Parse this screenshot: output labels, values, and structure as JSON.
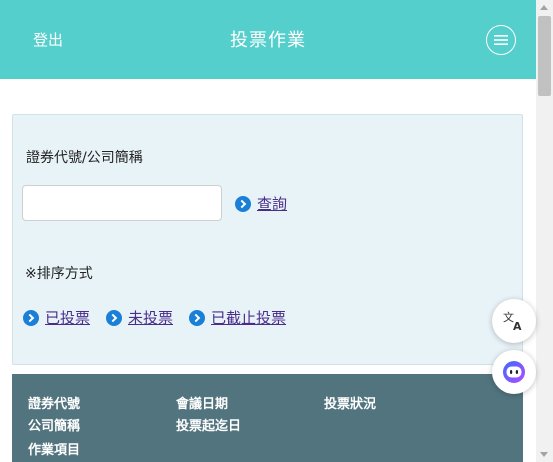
{
  "header": {
    "logout_label": "登出",
    "title": "投票作業",
    "menu_icon": "hamburger-menu-icon",
    "background": "#55cfcc"
  },
  "search": {
    "code_label": "證券代號/公司簡稱",
    "input_value": "",
    "input_placeholder": "",
    "query_label": "查詢"
  },
  "sort": {
    "label": "※排序方式",
    "options": [
      "已投票",
      "未投票",
      "已截止投票"
    ]
  },
  "table": {
    "headers": {
      "code": "證券代號",
      "meeting_date": "會議日期",
      "status": "投票狀況",
      "company": "公司簡稱",
      "vote_period": "投票起迄日",
      "items": "作業項目"
    },
    "background": "#51747f"
  },
  "floating": {
    "translate_icon": "translate-icon",
    "assistant_icon": "assistant-bot-icon"
  },
  "colors": {
    "accent": "#55cfcc",
    "link": "#4a2c8a",
    "link_icon": "#1a7fd6",
    "panel_bg": "#e8f3f8"
  }
}
